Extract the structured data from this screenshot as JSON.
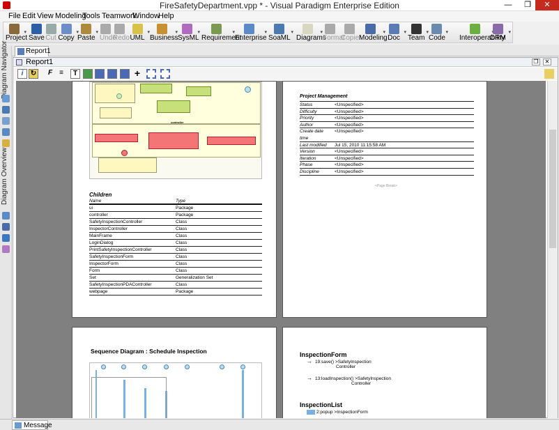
{
  "window": {
    "title": "FireSafetyDepartment.vpp * - Visual Paradigm Enterprise Edition"
  },
  "menu": [
    "File",
    "Edit",
    "View",
    "Modeling",
    "Tools",
    "Teamwork",
    "Window",
    "Help"
  ],
  "toolbar": {
    "items": [
      {
        "label": "Project",
        "color": "#8a6a3a",
        "arrow": true,
        "enabled": true
      },
      {
        "label": "Save",
        "color": "#2b5fa8",
        "arrow": false,
        "enabled": true
      },
      {
        "label": "Cut",
        "color": "#9aa",
        "arrow": false,
        "enabled": false
      },
      {
        "label": "Copy",
        "color": "#6c8ec8",
        "arrow": true,
        "enabled": true
      },
      {
        "label": "Paste",
        "color": "#b08a3c",
        "arrow": true,
        "enabled": true
      },
      {
        "label": "Undo",
        "color": "#aaa",
        "arrow": false,
        "enabled": false
      },
      {
        "label": "Redo",
        "color": "#aaa",
        "arrow": false,
        "enabled": false
      },
      {
        "label": "UML",
        "color": "#d8c24a",
        "arrow": true,
        "enabled": true
      },
      {
        "label": "Business",
        "color": "#c89030",
        "arrow": true,
        "enabled": true
      },
      {
        "label": "SysML",
        "color": "#b06ac0",
        "arrow": true,
        "enabled": true
      },
      {
        "label": "Requirement",
        "color": "#7a9a50",
        "arrow": true,
        "enabled": true
      },
      {
        "label": "Enterprise",
        "color": "#5a8ac8",
        "arrow": true,
        "enabled": true
      },
      {
        "label": "SoaML",
        "color": "#4a7ab0",
        "arrow": true,
        "enabled": true
      },
      {
        "label": "Diagrams",
        "color": "#d8d8c0",
        "arrow": true,
        "enabled": true
      },
      {
        "label": "Format",
        "color": "#aaa",
        "arrow": false,
        "enabled": false
      },
      {
        "label": "Copier",
        "color": "#aaa",
        "arrow": false,
        "enabled": false
      },
      {
        "label": "Modeling",
        "color": "#4a6aa8",
        "arrow": true,
        "enabled": true
      },
      {
        "label": "Doc",
        "color": "#5a7ab8",
        "arrow": true,
        "enabled": true
      },
      {
        "label": "Team",
        "color": "#333",
        "arrow": true,
        "enabled": true
      },
      {
        "label": "Code",
        "color": "#6a8ab0",
        "arrow": true,
        "enabled": true
      },
      {
        "label": "Interoperability",
        "color": "#6ab040",
        "arrow": true,
        "enabled": true
      },
      {
        "label": "ORM",
        "color": "#8a6aa8",
        "arrow": true,
        "enabled": true
      }
    ]
  },
  "tabs": {
    "document_tab": "Report1"
  },
  "left_panel": {
    "navigator_label": "Diagram Navigator",
    "overview_label": "Diagram Overview"
  },
  "report": {
    "title": "Report1",
    "children": {
      "heading": "Children",
      "columns": [
        "Name",
        "Type"
      ],
      "rows": [
        [
          "ui",
          "Package"
        ],
        [
          "controller",
          "Package"
        ],
        [
          "SafetyInspectionController",
          "Class"
        ],
        [
          "InspectorController",
          "Class"
        ],
        [
          "MainFrame",
          "Class"
        ],
        [
          "LoginDialog",
          "Class"
        ],
        [
          "PrintSafetyInspectionController",
          "Class"
        ],
        [
          "SafetyInspectionForm",
          "Class"
        ],
        [
          "InspectorForm",
          "Class"
        ],
        [
          "Form",
          "Class"
        ],
        [
          "Set",
          "Generalization Set"
        ],
        [
          "SafetyInspectionPDAController",
          "Class"
        ],
        [
          "webpage",
          "Package"
        ]
      ]
    },
    "diagram_labels": {
      "controller_package": "controller"
    },
    "project_management": {
      "heading": "Project Management",
      "rows": [
        [
          "Status",
          "<Unspecified>"
        ],
        [
          "Difficulty",
          "<Unspecified>"
        ],
        [
          "Priority",
          "<Unspecified>"
        ],
        [
          "Author",
          "<Unspecified>"
        ],
        [
          "Create date",
          "<Unspecified>"
        ],
        [
          "time",
          ""
        ],
        [
          "Last modified",
          "Jul 15, 2010 11:15:58 AM"
        ],
        [
          "Version",
          "<Unspecified>"
        ],
        [
          "Iteration",
          "<Unspecified>"
        ],
        [
          "Phase",
          "<Unspecified>"
        ],
        [
          "Discipline",
          "<Unspecified>"
        ]
      ]
    },
    "page_break": "<Page Break>",
    "sequence_heading": "Sequence Diagram : Schedule Inspection",
    "inspection_form": {
      "heading": "InspectionForm",
      "lines": [
        [
          "19:save() >SafetyInspection",
          "Controller"
        ],
        [
          "13:loadInspection() >SafetyInspection",
          "Controller"
        ]
      ]
    },
    "inspection_list": {
      "heading": "InspectionList",
      "line": "2:popup >InspectionForm"
    }
  },
  "bottom": {
    "message_tab": "Message"
  }
}
